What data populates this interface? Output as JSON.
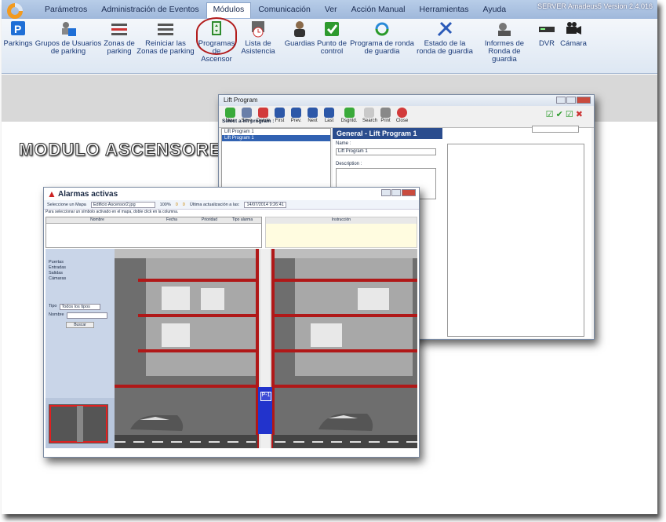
{
  "menubar": {
    "items": [
      "Parámetros",
      "Administración de Eventos",
      "Módulos",
      "Comunicación",
      "Ver",
      "Acción Manual",
      "Herramientas",
      "Ayuda"
    ],
    "version": "SERVER Amadeus5 Version 2.4.016"
  },
  "ribbon": [
    {
      "label": "Parkings",
      "icon": "parking-icon"
    },
    {
      "label": "Grupos de Usuarios de parking",
      "icon": "users-group-icon"
    },
    {
      "label": "Zonas de parking",
      "icon": "parking-zone-icon"
    },
    {
      "label": "Reiniciar las Zonas de parking",
      "icon": "reset-zone-icon"
    },
    {
      "label": "Programas de Ascensor",
      "icon": "elevator-icon"
    },
    {
      "label": "Lista de Asistencia",
      "icon": "attendance-icon"
    },
    {
      "label": "Guardias",
      "icon": "guard-icon"
    },
    {
      "label": "Punto de control",
      "icon": "checkpoint-icon"
    },
    {
      "label": "Programa de ronda de guardia",
      "icon": "round-program-icon"
    },
    {
      "label": "Estado de la ronda de guardia",
      "icon": "round-state-icon"
    },
    {
      "label": "Informes de Ronda de guardia",
      "icon": "round-report-icon"
    },
    {
      "label": "DVR",
      "icon": "dvr-icon"
    },
    {
      "label": "Cámara",
      "icon": "camera-icon"
    }
  ],
  "banner": "MODULO ASCENSORES",
  "lift": {
    "title": "Lift Program",
    "toolbar": [
      "New",
      "Save",
      "Delete",
      "First",
      "Prev.",
      "Next",
      "Last",
      "Dsgntd.",
      "Search",
      "Print",
      "Close"
    ],
    "select_label": "Select a lift program :",
    "programs": [
      "Lift Program 1",
      "Lift Program 1"
    ],
    "header": "General - Lift Program 1",
    "name_label": "Name :",
    "name_value": "Lift Program 1",
    "desc_label": "Description :"
  },
  "alarm": {
    "title": "Alarmas activas",
    "map_label": "Seleccione un Mapa",
    "map_value": "Edificio Ascensor2.jpg",
    "zoom": "100%",
    "counts": [
      "0",
      "0"
    ],
    "last_update_label": "Última actualización a las:",
    "last_update": "14/07/2014 9:26:41",
    "hint": "Para seleccionar un símbolo activado en el mapa, doble click en la columna.",
    "cols": [
      "Nombre",
      "Fecha",
      "Prioridad",
      "Tipo alarma"
    ],
    "instruction": "Instrucción",
    "tree": [
      "Puertas",
      "Entradas",
      "Salidas",
      "Cámaras"
    ],
    "type_label": "Tipo",
    "type_value": "Todos los tipos",
    "name_label": "Nombre",
    "search_btn": "Buscar",
    "elevator_label": "P-1"
  }
}
